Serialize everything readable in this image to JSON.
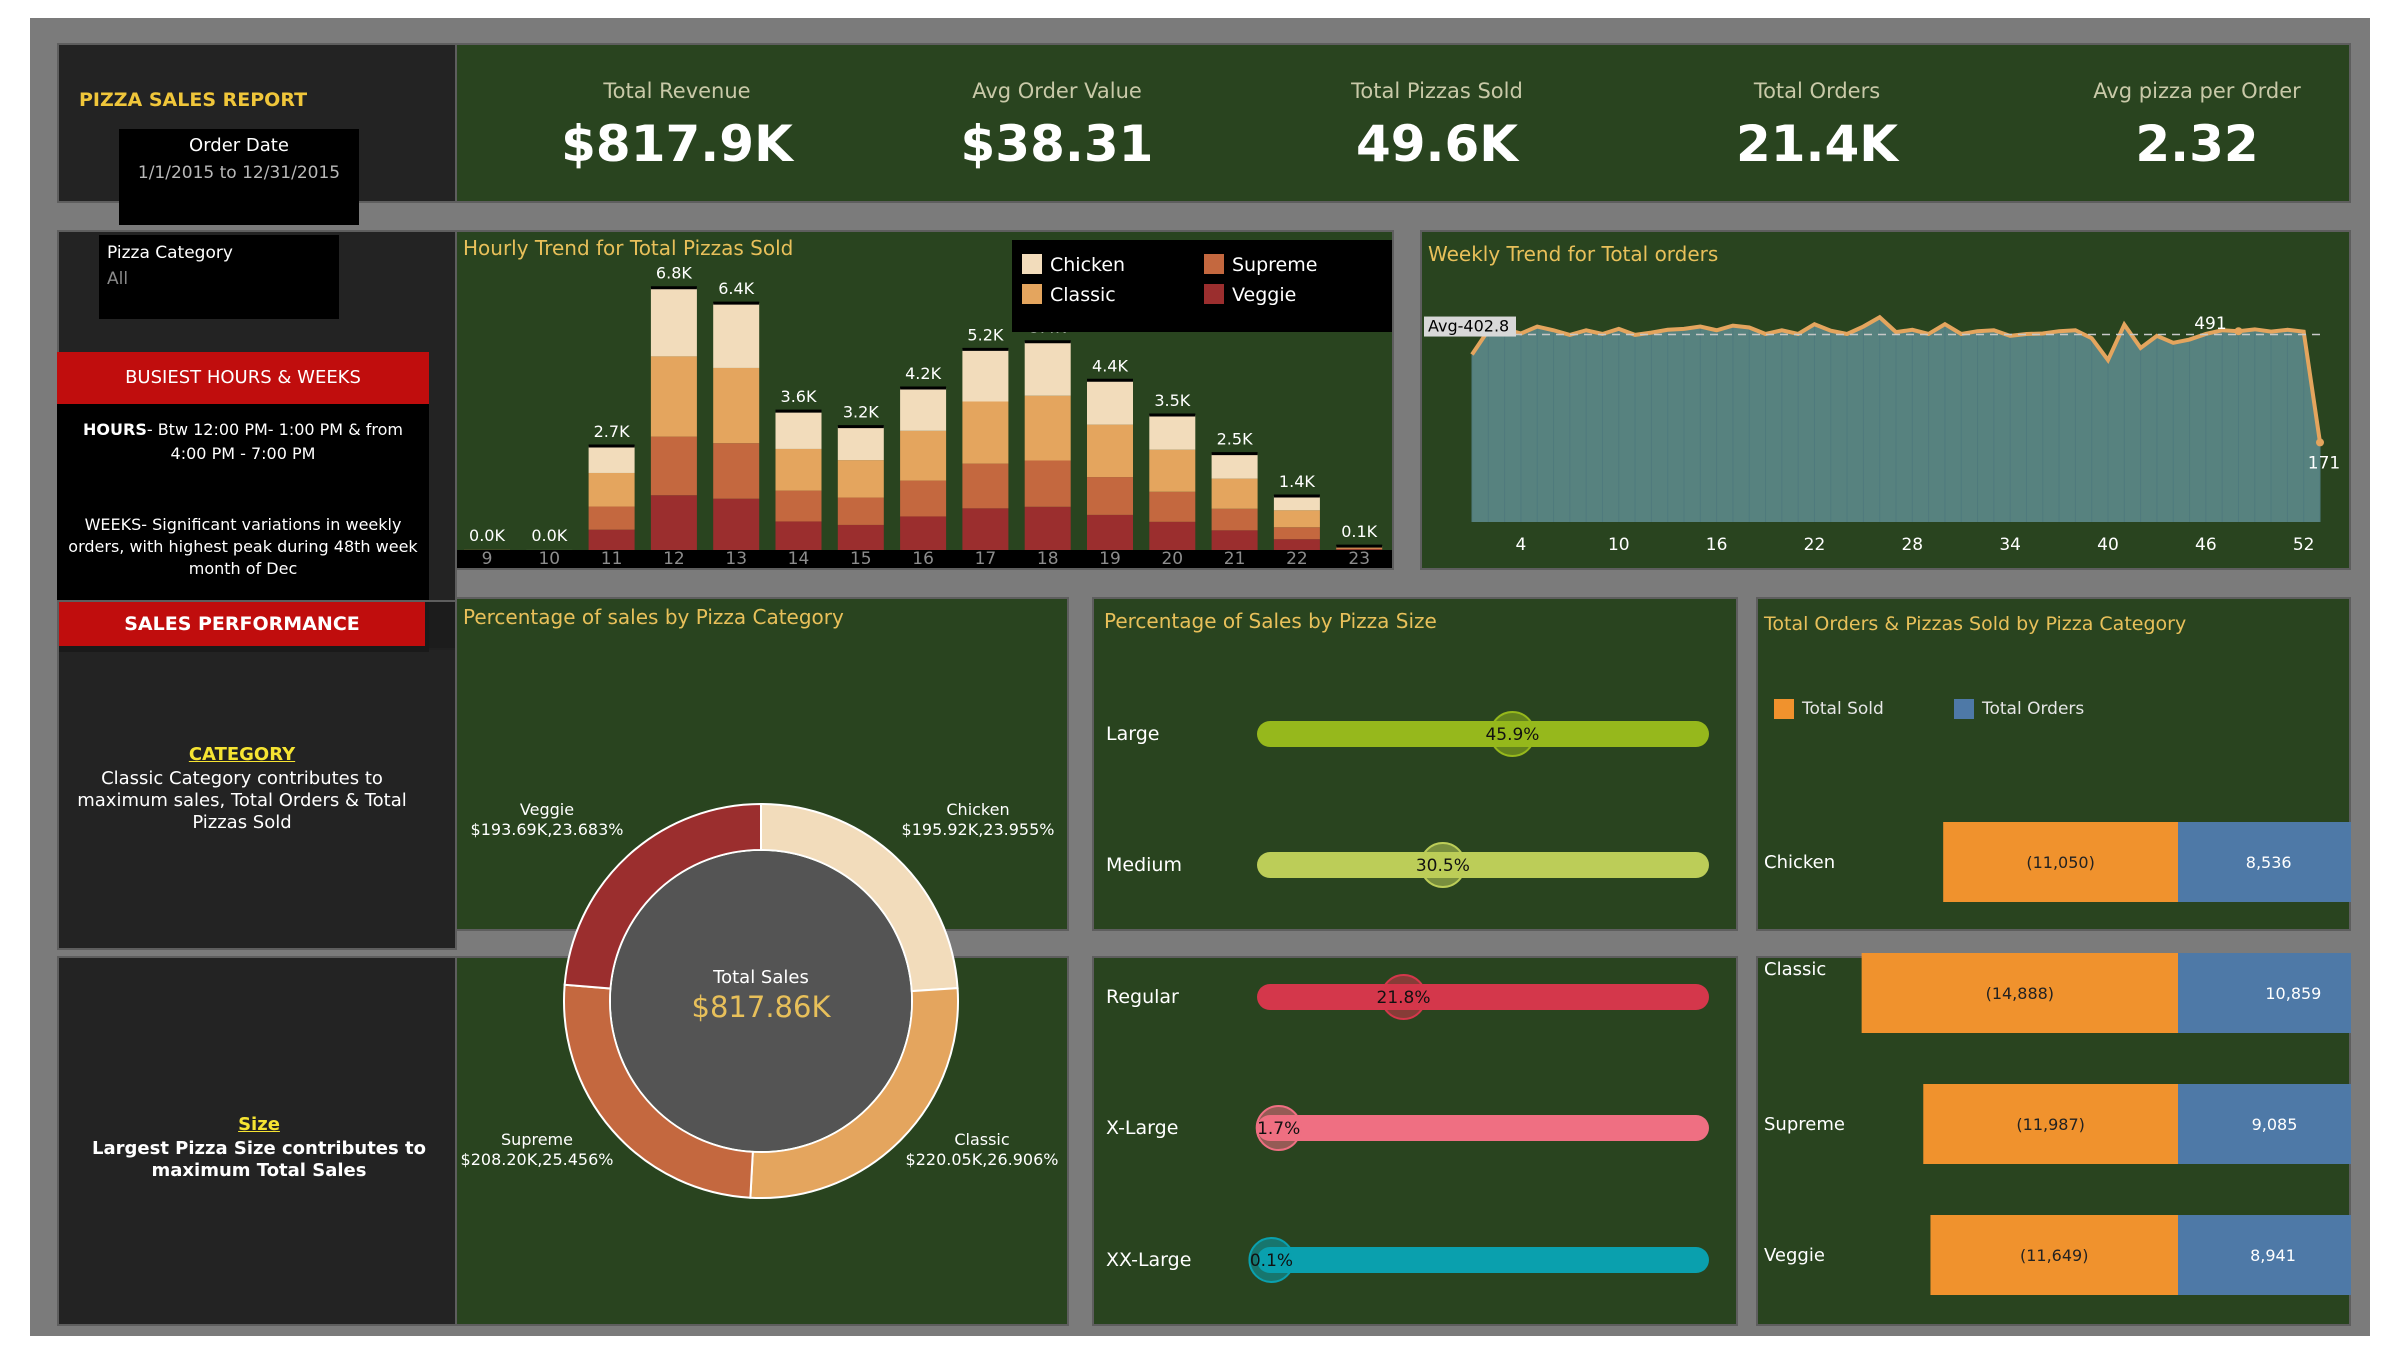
{
  "report": {
    "title": "PIZZA SALES REPORT",
    "order_date_label": "Order Date",
    "order_date_value": "1/1/2015 to 12/31/2015",
    "category_filter_label": "Pizza Category",
    "category_filter_value": "All"
  },
  "busiest": {
    "header": "BUSIEST HOURS & WEEKS",
    "hours_label": "HOURS",
    "hours_text": "- Btw 12:00 PM- 1:00 PM & from 4:00 PM - 7:00 PM",
    "weeks_text": "WEEKS- Significant variations in weekly orders, with highest peak during 48th week month of Dec"
  },
  "performance": {
    "header": "SALES PERFORMANCE",
    "category_title": "CATEGORY",
    "category_text": "Classic Category contributes to maximum sales, Total Orders & Total Pizzas Sold",
    "size_title": "Size",
    "size_text": "Largest Pizza Size contributes to maximum Total Sales"
  },
  "kpis": [
    {
      "label": "Total Revenue",
      "value": "$817.9K"
    },
    {
      "label": "Avg Order Value",
      "value": "$38.31"
    },
    {
      "label": "Total Pizzas Sold",
      "value": "49.6K"
    },
    {
      "label": "Total Orders",
      "value": "21.4K"
    },
    {
      "label": "Avg pizza per Order",
      "value": "2.32"
    }
  ],
  "colors": {
    "chicken": "#f2dcbb",
    "classic": "#e4a55e",
    "supreme": "#c4683f",
    "veggie": "#9b2e2e",
    "accent": "#e8c05a",
    "total_sold": "#f0922d",
    "total_orders": "#4e79a7",
    "line": "#e4a55e",
    "area": "#5f8d90"
  },
  "chart_data": [
    {
      "type": "bar",
      "title": "Hourly Trend for Total Pizzas Sold",
      "stacked": true,
      "categories": [
        "9",
        "10",
        "11",
        "12",
        "13",
        "14",
        "15",
        "16",
        "17",
        "18",
        "19",
        "20",
        "21",
        "22",
        "23"
      ],
      "totals": [
        "0.0K",
        "0.0K",
        "2.7K",
        "6.8K",
        "6.4K",
        "3.6K",
        "3.2K",
        "4.2K",
        "5.2K",
        "5.4K",
        "4.4K",
        "3.5K",
        "2.5K",
        "1.4K",
        "0.1K"
      ],
      "series": [
        {
          "name": "Veggie",
          "values": [
            1,
            0,
            527,
            1420,
            1330,
            740,
            650,
            870,
            1080,
            1120,
            910,
            730,
            510,
            280,
            20
          ]
        },
        {
          "name": "Supreme",
          "values": [
            1,
            0,
            600,
            1520,
            1440,
            800,
            710,
            930,
            1160,
            1200,
            980,
            780,
            560,
            310,
            20
          ]
        },
        {
          "name": "Classic",
          "values": [
            2,
            0,
            870,
            2080,
            1950,
            1080,
            970,
            1290,
            1610,
            1680,
            1360,
            1090,
            780,
            440,
            30
          ]
        },
        {
          "name": "Chicken",
          "values": [
            0,
            1,
            700,
            1780,
            1680,
            980,
            870,
            1110,
            1350,
            1400,
            1150,
            900,
            650,
            370,
            30
          ]
        }
      ],
      "legend": [
        "Chicken",
        "Supreme",
        "Classic",
        "Veggie"
      ],
      "legend_position": "top-right",
      "ylim": [
        0,
        7000
      ]
    },
    {
      "type": "area",
      "title": "Weekly Trend for Total orders",
      "x_ticks": [
        "4",
        "10",
        "16",
        "22",
        "28",
        "34",
        "40",
        "46",
        "52"
      ],
      "x": [
        1,
        2,
        3,
        4,
        5,
        6,
        7,
        8,
        9,
        10,
        11,
        12,
        13,
        14,
        15,
        16,
        17,
        18,
        19,
        20,
        21,
        22,
        23,
        24,
        25,
        26,
        27,
        28,
        29,
        30,
        31,
        32,
        33,
        34,
        35,
        36,
        37,
        38,
        39,
        40,
        41,
        42,
        43,
        44,
        45,
        46,
        47,
        48,
        49,
        50,
        51,
        52,
        53
      ],
      "values": [
        360,
        412,
        415,
        405,
        420,
        412,
        402,
        412,
        404,
        415,
        402,
        407,
        413,
        415,
        420,
        412,
        422,
        418,
        404,
        412,
        404,
        425,
        411,
        404,
        420,
        440,
        408,
        413,
        404,
        425,
        404,
        410,
        412,
        400,
        404,
        405,
        410,
        412,
        395,
        348,
        424,
        374,
        400,
        385,
        392,
        404,
        412,
        410,
        414,
        409,
        413,
        409,
        171
      ],
      "average": 402.8,
      "average_label": "Avg-402.8",
      "annotations": [
        {
          "x": 48,
          "label": "491"
        },
        {
          "x": 53,
          "label": "171"
        }
      ],
      "ylim": [
        0,
        520
      ]
    },
    {
      "type": "pie",
      "title": "Percentage of sales by Pizza Category",
      "center_label": "Total Sales",
      "center_value": "$817.86K",
      "slices": [
        {
          "name": "Chicken",
          "value": 195.92,
          "percent": 23.955,
          "label": "$195.92K,23.955%"
        },
        {
          "name": "Classic",
          "value": 220.05,
          "percent": 26.906,
          "label": "$220.05K,26.906%"
        },
        {
          "name": "Supreme",
          "value": 208.2,
          "percent": 25.456,
          "label": "$208.20K,25.456%"
        },
        {
          "name": "Veggie",
          "value": 193.69,
          "percent": 23.683,
          "label": "$193.69K,23.683%"
        }
      ]
    },
    {
      "type": "bar",
      "title": "Percentage of Sales by Pizza Size",
      "categories": [
        "Large",
        "Medium",
        "Regular",
        "X-Large",
        "XX-Large"
      ],
      "values": [
        45.9,
        30.5,
        21.8,
        1.7,
        0.1
      ],
      "labels": [
        "45.9%",
        "30.5%",
        "21.8%",
        "1.7%",
        "0.1%"
      ],
      "colors": [
        "#96b81c",
        "#bccd58",
        "#d4374b",
        "#ef6f82",
        "#0aa0ae"
      ],
      "xlim": [
        0,
        100
      ]
    },
    {
      "type": "bar",
      "title": "Total Orders & Pizzas Sold by Pizza Category",
      "categories": [
        "Chicken",
        "Classic",
        "Supreme",
        "Veggie"
      ],
      "series": [
        {
          "name": "Total Sold",
          "values": [
            11050,
            14888,
            11987,
            11649
          ],
          "labels": [
            "(11,050)",
            "(14,888)",
            "(11,987)",
            "(11,649)"
          ]
        },
        {
          "name": "Total Orders",
          "values": [
            8536,
            10859,
            9085,
            8941
          ],
          "labels": [
            "8,536",
            "10,859",
            "9,085",
            "8,941"
          ]
        }
      ],
      "legend_position": "top-left",
      "xlim": [
        0,
        16000
      ]
    }
  ]
}
